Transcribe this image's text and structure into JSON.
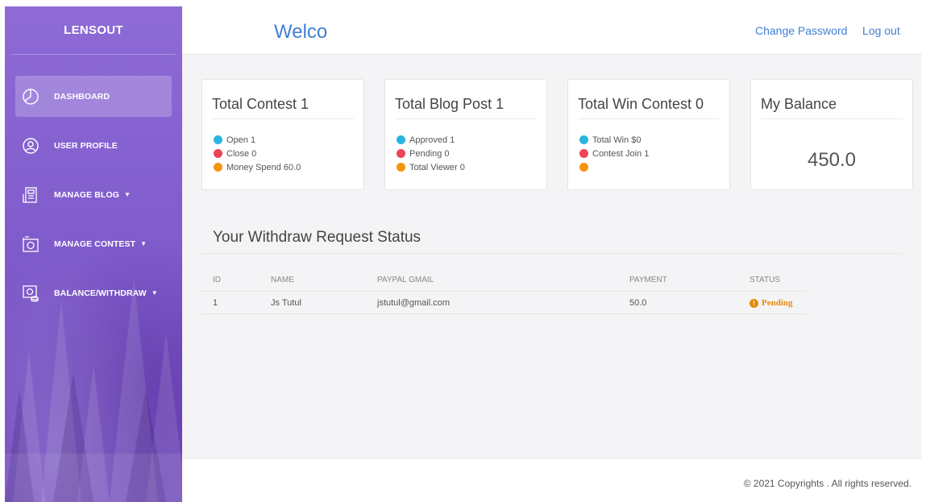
{
  "sidebar": {
    "brand": "LENSOUT",
    "items": [
      {
        "label": "DASHBOARD",
        "icon": "pie-chart-icon",
        "active": true
      },
      {
        "label": "USER PROFILE",
        "icon": "user-circle-icon",
        "active": false
      },
      {
        "label": "MANAGE BLOG",
        "icon": "blog-document-icon",
        "active": false,
        "has_dropdown": true
      },
      {
        "label": "MANAGE CONTEST",
        "icon": "camera-icon",
        "active": false,
        "has_dropdown": true
      },
      {
        "label": "BALANCE/WITHDRAW",
        "icon": "money-withdraw-icon",
        "active": false,
        "has_dropdown": true
      }
    ],
    "caret": "▼"
  },
  "header": {
    "welcome": "Welco",
    "change_password": "Change Password",
    "logout": "Log out"
  },
  "cards": [
    {
      "title": "Total Contest 1",
      "rows": [
        {
          "dot_color": "#29b6e0",
          "text": "Open 1"
        },
        {
          "dot_color": "#ee4456",
          "text": "Close 0"
        },
        {
          "dot_color": "#f5940f",
          "text": "Money Spend 60.0"
        }
      ]
    },
    {
      "title": "Total Blog Post 1",
      "rows": [
        {
          "dot_color": "#29b6e0",
          "text": "Approved 1"
        },
        {
          "dot_color": "#ee4456",
          "text": "Pending 0"
        },
        {
          "dot_color": "#f5940f",
          "text": "Total Viewer 0"
        }
      ]
    },
    {
      "title": "Total Win Contest 0",
      "rows": [
        {
          "dot_color": "#29b6e0",
          "text": "Total Win $0"
        },
        {
          "dot_color": "#ee4456",
          "text": "Contest Join 1"
        },
        {
          "dot_color": "#f5940f",
          "text": ""
        }
      ]
    },
    {
      "title": "My Balance",
      "value": "450.0"
    }
  ],
  "withdraw": {
    "title": "Your Withdraw Request Status",
    "columns": [
      "ID",
      "NAME",
      "PAYPAL GMAIL",
      "PAYMENT",
      "STATUS"
    ],
    "rows": [
      {
        "id": "1",
        "name": "Js Tutul",
        "email": "jstutul@gmail.com",
        "payment": "50.0",
        "status": "Pending",
        "status_icon": "!"
      }
    ]
  },
  "footer": {
    "copyright": "© 2021 Copyrights . All rights reserved."
  }
}
